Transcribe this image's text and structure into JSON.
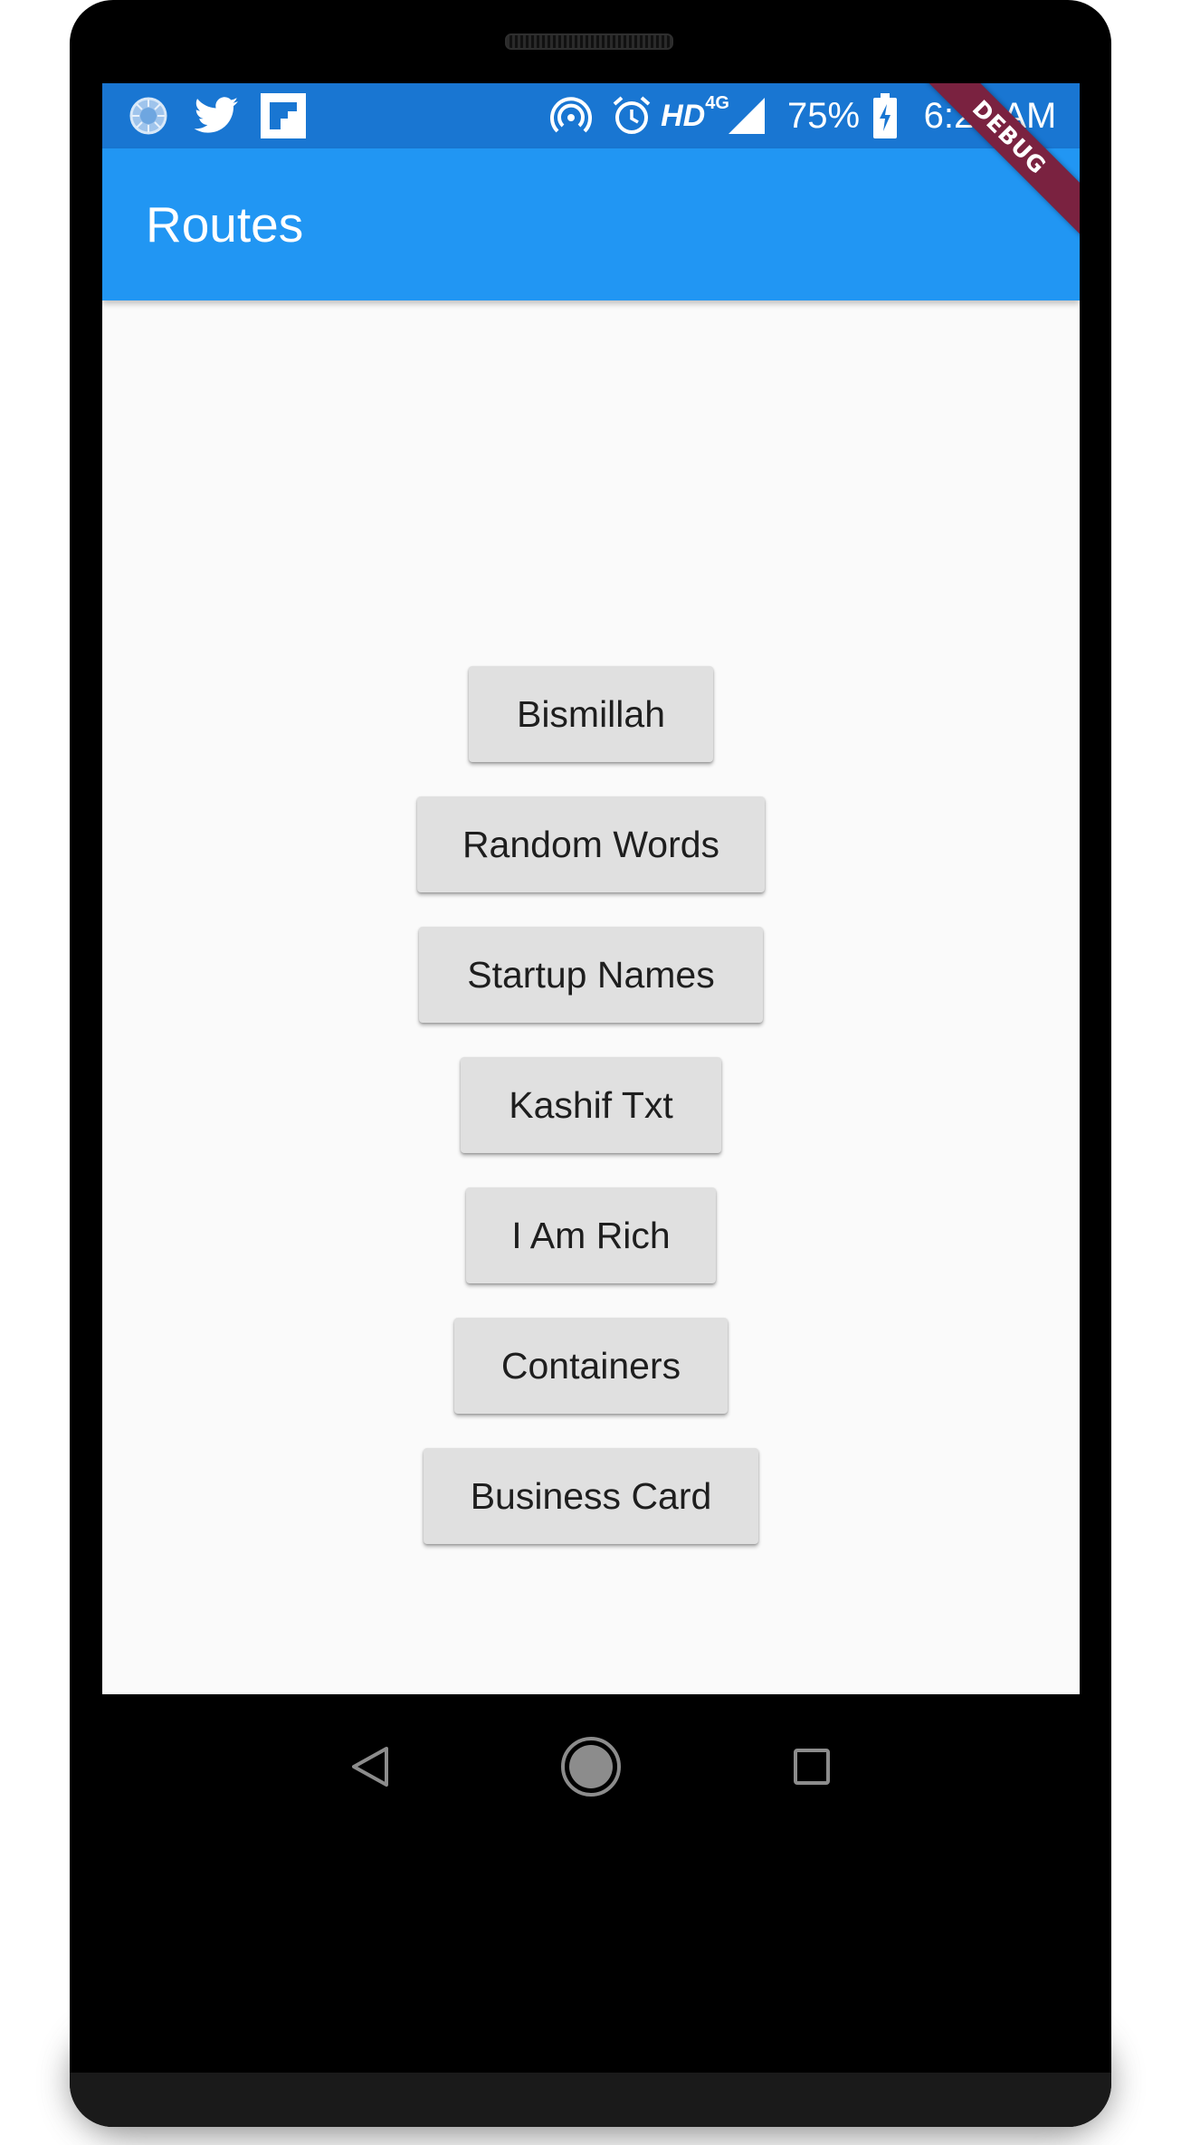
{
  "status_bar": {
    "notification_icons": [
      "chrome-sync-icon",
      "twitter-icon",
      "flipboard-icon"
    ],
    "system_icons": [
      "hotspot-icon",
      "alarm-icon",
      "signal-icon",
      "battery-charging-icon"
    ],
    "network_label": "HD",
    "network_type": "4G",
    "battery_percent": "75%",
    "time": "6:23 AM"
  },
  "app_bar": {
    "title": "Routes"
  },
  "debug_banner": "DEBUG",
  "routes": [
    {
      "label": "Bismillah"
    },
    {
      "label": "Random Words"
    },
    {
      "label": "Startup Names"
    },
    {
      "label": "Kashif Txt"
    },
    {
      "label": "I Am Rich"
    },
    {
      "label": "Containers"
    },
    {
      "label": "Business Card"
    }
  ],
  "nav_bar": {
    "buttons": [
      "back-icon",
      "home-icon",
      "recents-icon"
    ]
  },
  "colors": {
    "status_bar": "#1976d2",
    "app_bar": "#2196f3",
    "background": "#fafafa",
    "button": "#e0e0e0",
    "debug_banner": "#7a2240"
  }
}
